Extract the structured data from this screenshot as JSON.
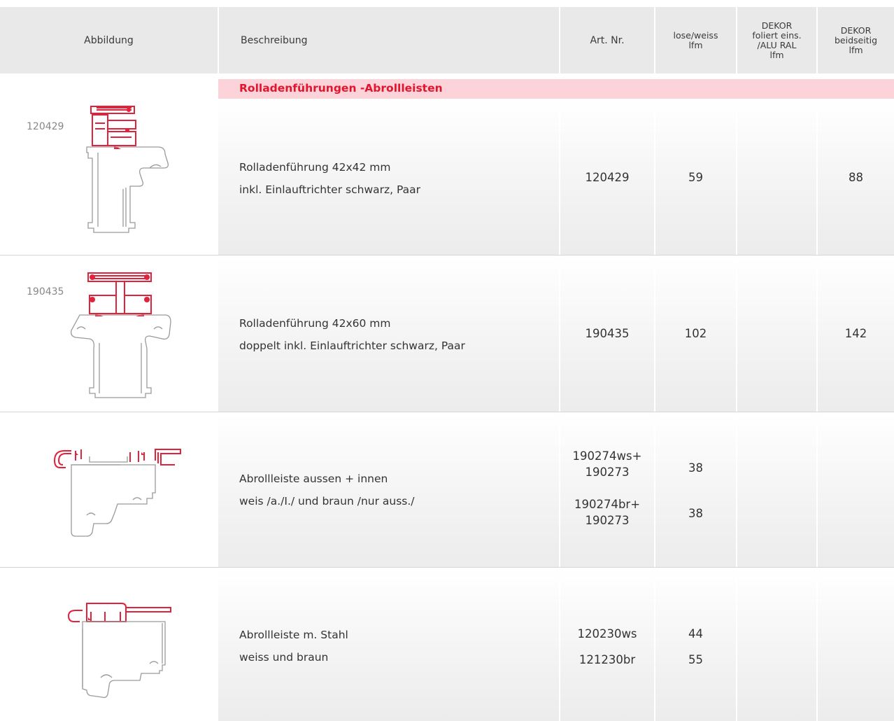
{
  "headers": {
    "abbildung": "Abbildung",
    "beschreibung": "Beschreibung",
    "art_nr": "Art. Nr.",
    "lose_weiss": [
      "lose/weiss",
      "lfm"
    ],
    "dekor_foliert": [
      "DEKOR",
      "foliert eins.",
      "/ALU RAL",
      "lfm"
    ],
    "dekor_beidseitig": [
      "DEKOR",
      "beidseitig",
      "lfm"
    ]
  },
  "section_title": "Rolladenführungen -Abrollleisten",
  "rows": [
    {
      "image_code": "120429",
      "desc_line1": "Rolladenführung 42x42 mm",
      "desc_line2": "inkl. Einlauftrichter schwarz, Paar",
      "art_nr": "120429",
      "lose_weiss": "59",
      "dekor_foliert": "",
      "dekor_beidseitig": "88"
    },
    {
      "image_code": "190435",
      "desc_line1": "Rolladenführung 42x60 mm",
      "desc_line2": "doppelt inkl. Einlauftrichter schwarz, Paar",
      "art_nr": "190435",
      "lose_weiss": "102",
      "dekor_foliert": "",
      "dekor_beidseitig": "142"
    },
    {
      "image_code": "",
      "desc_line1": "Abrollleiste aussen + innen",
      "desc_line2": "weis /a./I./ und braun /nur auss./",
      "art_nr_a1": "190274ws+",
      "art_nr_a2": "190273",
      "art_nr_b1": "190274br+",
      "art_nr_b2": "190273",
      "lose_weiss_a": "38",
      "lose_weiss_b": "38",
      "dekor_foliert": "",
      "dekor_beidseitig": ""
    },
    {
      "image_code": "",
      "desc_line1": "Abrollleiste m. Stahl",
      "desc_line2": "weiss und braun",
      "art_nr_a": "120230ws",
      "art_nr_b": "121230br",
      "lose_weiss_a": "44",
      "lose_weiss_b": "55",
      "dekor_foliert": "",
      "dekor_beidseitig": ""
    }
  ],
  "colors": {
    "accent": "#e3142e",
    "band": "#fbd3d8",
    "header_bg": "#e9e9e9",
    "profile_red": "#e0233a",
    "profile_grey": "#9a9a9a"
  }
}
